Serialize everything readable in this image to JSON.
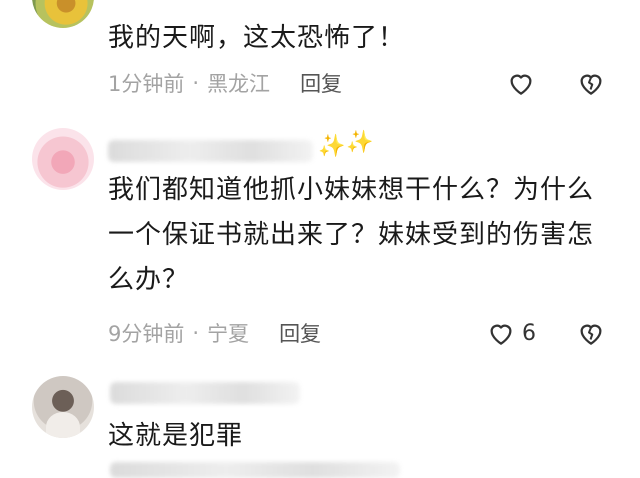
{
  "comments": [
    {
      "text": "我的天啊，这太恐怖了！",
      "time": "1分钟前",
      "location": "黑龙江",
      "reply_label": "回复",
      "like_count": ""
    },
    {
      "text": "我们都知道他抓小妹妹想干什么？为什么一个保证书就出来了？妹妹受到的伤害怎么办？",
      "time": "9分钟前",
      "location": "宁夏",
      "reply_label": "回复",
      "like_count": "6"
    },
    {
      "text": "这就是犯罪",
      "time": "",
      "location": "",
      "reply_label": "",
      "like_count": ""
    }
  ],
  "meta_separator": "·",
  "icons": {
    "like": "heart-outline-icon",
    "dislike": "broken-heart-icon",
    "sparkle": "sparkle-icon"
  },
  "colors": {
    "meta_gray": "#a3a3a3",
    "sparkle": "#f2c94c",
    "text": "#1a1a1a"
  }
}
